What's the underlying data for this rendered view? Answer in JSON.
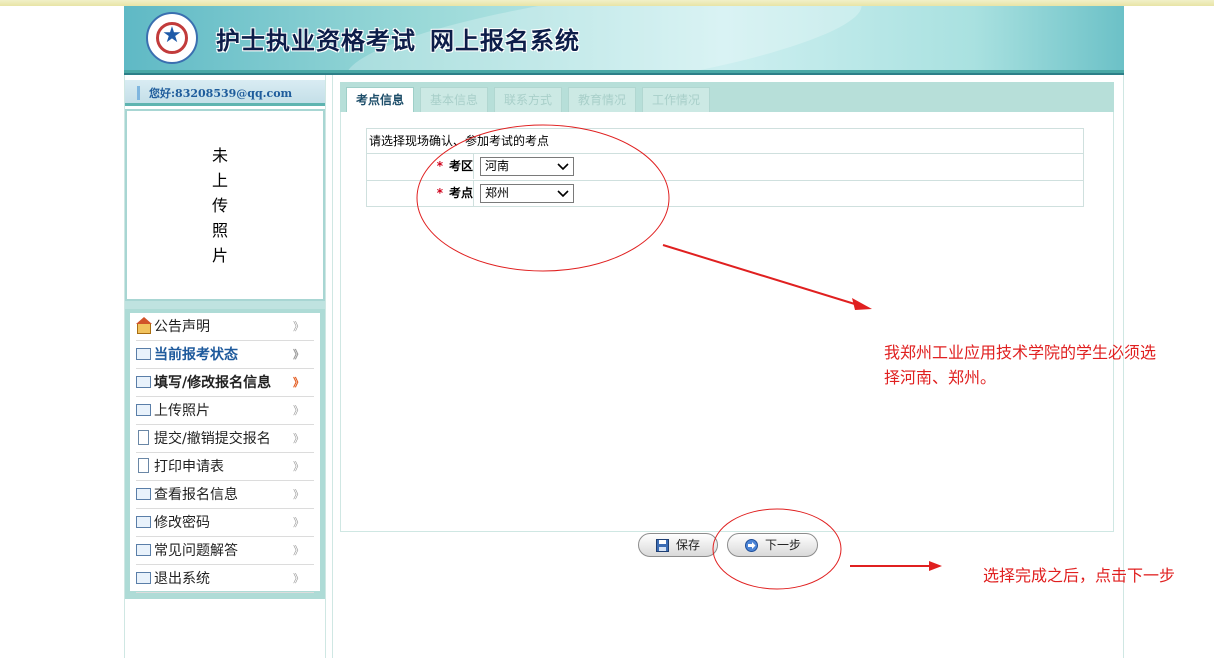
{
  "banner": {
    "title_main": "护士执业资格考试",
    "title_sub": "网上报名系统"
  },
  "user": {
    "greeting": "您好:83208539@qq.com"
  },
  "photo": {
    "placeholder": "未上传照片"
  },
  "menu": {
    "items": [
      {
        "label": "公告声明",
        "icon": "home-icon"
      },
      {
        "label": "当前报考状态",
        "icon": "card-icon"
      },
      {
        "label": "填写/修改报名信息",
        "icon": "card-icon"
      },
      {
        "label": "上传照片",
        "icon": "card-icon"
      },
      {
        "label": "提交/撤销提交报名",
        "icon": "document-icon"
      },
      {
        "label": "打印申请表",
        "icon": "document-icon"
      },
      {
        "label": "查看报名信息",
        "icon": "card-icon"
      },
      {
        "label": "修改密码",
        "icon": "card-icon"
      },
      {
        "label": "常见问题解答",
        "icon": "card-icon"
      },
      {
        "label": "退出系统",
        "icon": "card-icon"
      }
    ]
  },
  "tabs": [
    "考点信息",
    "基本信息",
    "联系方式",
    "教育情况",
    "工作情况"
  ],
  "form": {
    "instruction": "请选择现场确认、参加考试的考点",
    "region_label": "考区",
    "region_value": "河南",
    "site_label": "考点",
    "site_value": "郑州"
  },
  "buttons": {
    "save": "保存",
    "next": "下一步"
  },
  "annotations": {
    "note1_line1": "我郑州工业应用技术学院的学生必须选",
    "note1_line2": "择河南、郑州。",
    "note2": "选择完成之后，点击下一步"
  },
  "colors": {
    "annotation": "#e02020",
    "accent_band": "#4aa8a6",
    "tab_active_text": "#1e4e6a"
  }
}
